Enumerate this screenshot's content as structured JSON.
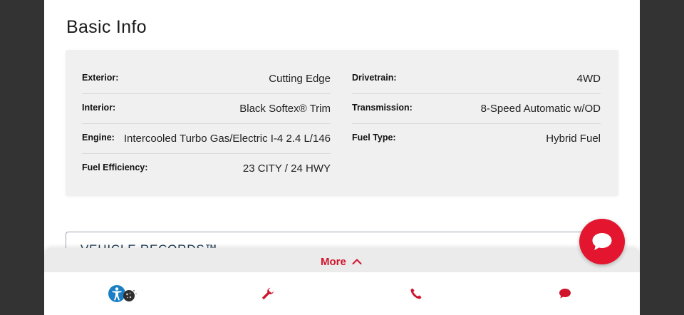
{
  "basic_info": {
    "title": "Basic Info",
    "left": [
      {
        "label": "Exterior:",
        "value": "Cutting Edge"
      },
      {
        "label": "Interior:",
        "value": "Black Softex® Trim"
      },
      {
        "label": "Engine:",
        "value": "Intercooled Turbo Gas/Electric I-4 2.4 L/146"
      },
      {
        "label": "Fuel Efficiency:",
        "value": "23 CITY / 24 HWY"
      }
    ],
    "right": [
      {
        "label": "Drivetrain:",
        "value": "4WD"
      },
      {
        "label": "Transmission:",
        "value": "8-Speed Automatic w/OD"
      },
      {
        "label": "Fuel Type:",
        "value": "Hybrid Fuel"
      }
    ]
  },
  "vehicle_records": {
    "title": "VEHICLE RECORDS™"
  },
  "more_bar": {
    "label": "More",
    "icon": "chevron-up-icon"
  },
  "bottom_nav": {
    "items": [
      {
        "name": "accessibility",
        "icon": "accessibility-icon"
      },
      {
        "name": "service",
        "icon": "wrench-icon"
      },
      {
        "name": "phone",
        "icon": "phone-icon"
      },
      {
        "name": "chat",
        "icon": "chat-bubble-icon"
      }
    ]
  },
  "chat_fab": {
    "icon": "chat-bubble-icon"
  },
  "colors": {
    "accent": "#e4162f",
    "more_text": "#d0142c",
    "card_bg": "#f0f0f0",
    "records_text": "#1e3a52",
    "frame": "#333333"
  }
}
